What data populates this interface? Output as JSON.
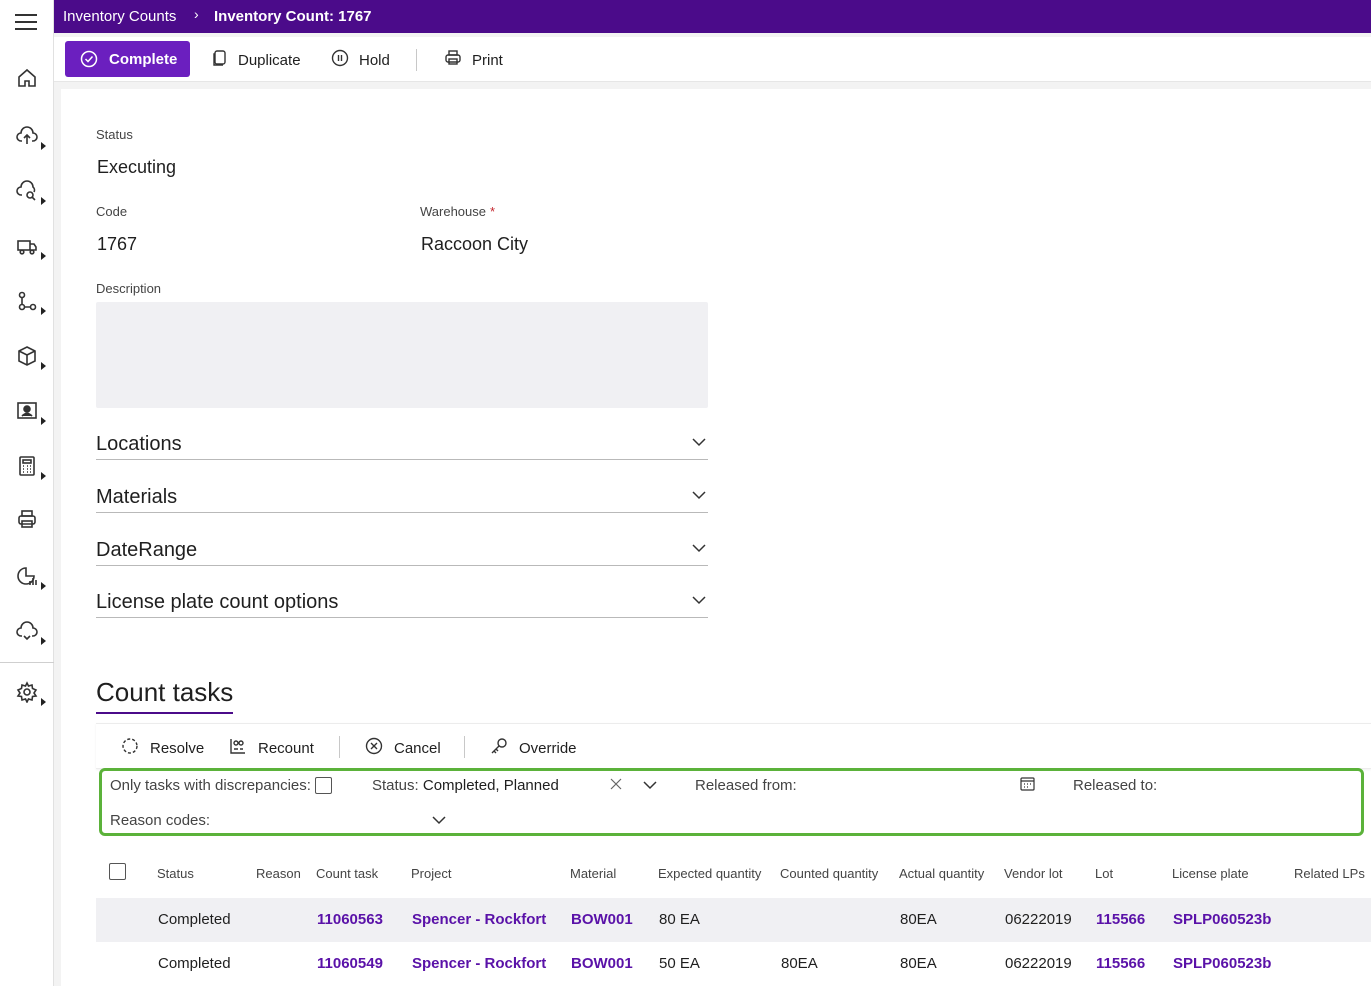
{
  "header": {
    "breadcrumb_parent": "Inventory Counts",
    "breadcrumb_separator": "›",
    "breadcrumb_current": "Inventory Count: 1767"
  },
  "sidebar": {
    "items": [
      {
        "icon": "home-icon"
      },
      {
        "icon": "cloud-upload-icon"
      },
      {
        "icon": "cloud-search-icon"
      },
      {
        "icon": "truck-icon"
      },
      {
        "icon": "workflow-icon"
      },
      {
        "icon": "box-icon"
      },
      {
        "icon": "user-card-icon"
      },
      {
        "icon": "calculator-icon"
      },
      {
        "icon": "printer-icon"
      },
      {
        "icon": "report-chart-icon"
      },
      {
        "icon": "cloud-sync-icon"
      },
      {
        "icon": "settings-gear-icon"
      }
    ]
  },
  "toolbar": {
    "complete": "Complete",
    "duplicate": "Duplicate",
    "hold": "Hold",
    "print": "Print"
  },
  "form": {
    "status_label": "Status",
    "status_value": "Executing",
    "code_label": "Code",
    "code_value": "1767",
    "warehouse_label": "Warehouse",
    "warehouse_required": "*",
    "warehouse_value": "Raccoon City",
    "description_label": "Description",
    "sections": [
      "Locations",
      "Materials",
      "DateRange",
      "License plate count options"
    ]
  },
  "count_tasks": {
    "title": "Count tasks",
    "actions": {
      "resolve": "Resolve",
      "recount": "Recount",
      "cancel": "Cancel",
      "override": "Override"
    },
    "filters": {
      "discrepancies_label": "Only tasks with discrepancies:",
      "status_label": "Status:",
      "status_value": "Completed, Planned",
      "released_from_label": "Released from:",
      "released_to_label": "Released to:",
      "reason_codes_label": "Reason codes:"
    },
    "columns": [
      "Status",
      "Reason",
      "Count task",
      "Project",
      "Material",
      "Expected quantity",
      "Counted quantity",
      "Actual quantity",
      "Vendor lot",
      "Lot",
      "License plate",
      "Related LPs"
    ],
    "rows": [
      {
        "status": "Completed",
        "reason": "",
        "count_task": "11060563",
        "project": "Spencer - Rockfort",
        "material": "BOW001",
        "expected": "80 EA",
        "counted": "",
        "actual": "80EA",
        "vendor_lot": "06222019",
        "lot": "115566",
        "license_plate": "SPLP060523b",
        "related": ""
      },
      {
        "status": "Completed",
        "reason": "",
        "count_task": "11060549",
        "project": "Spencer - Rockfort",
        "material": "BOW001",
        "expected": "50 EA",
        "counted": "80EA",
        "actual": "80EA",
        "vendor_lot": "06222019",
        "lot": "115566",
        "license_plate": "SPLP060523b",
        "related": ""
      }
    ]
  },
  "colors": {
    "header_bg": "#4b0b8a",
    "primary_button": "#6b1fbf",
    "link": "#5a12a8",
    "filter_highlight": "#5bb23a"
  }
}
